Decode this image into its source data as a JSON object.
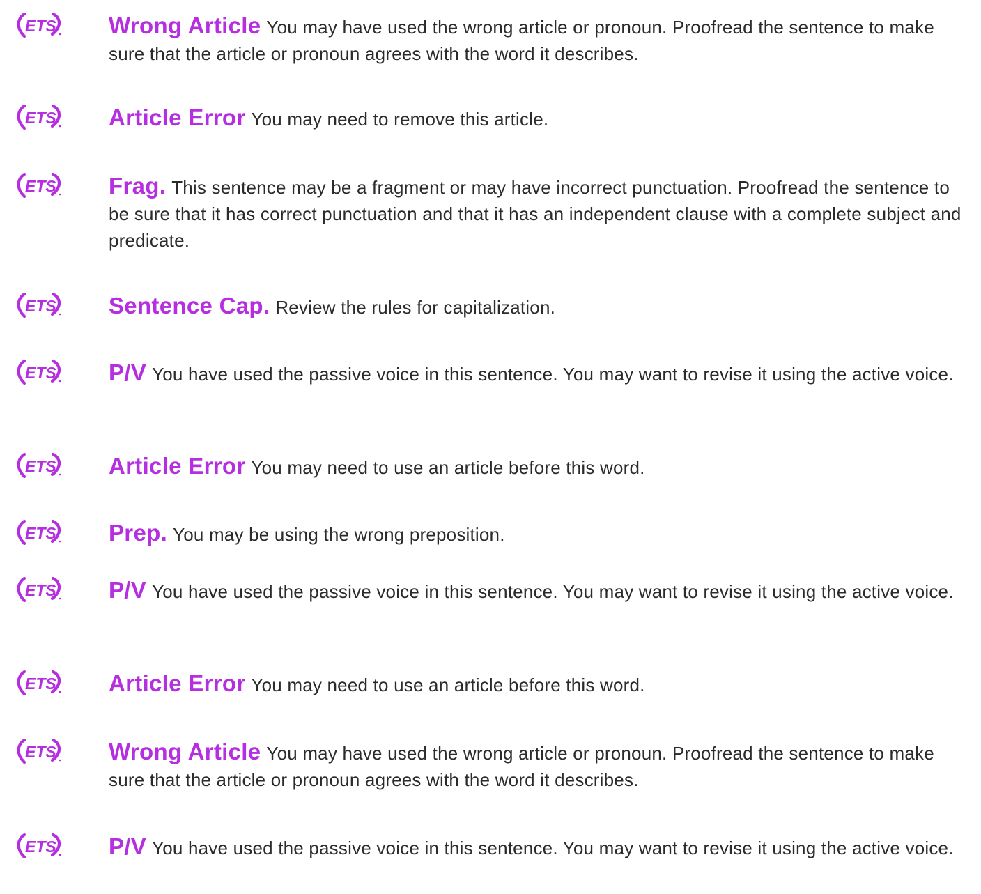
{
  "theme": {
    "accent": "#b52fe0",
    "text": "#2b2b2b",
    "background": "#ffffff"
  },
  "logo": {
    "text": "ETS",
    "icon": "ets-logo-icon"
  },
  "items": [
    {
      "title": "Wrong Article",
      "message": "You may have used the wrong article or pronoun. Proofread the sentence to make sure that the article or pronoun agrees with the word it describes."
    },
    {
      "title": "Article Error",
      "message": "You may need to remove this article."
    },
    {
      "title": "Frag.",
      "message": "This sentence may be a fragment or may have incorrect punctuation. Proofread the sentence to be sure that it has correct punctuation and that it has an independent clause with a complete subject and predicate."
    },
    {
      "title": "Sentence Cap.",
      "message": "Review the rules for capitalization."
    },
    {
      "title": "P/V",
      "message": "You have used the passive voice in this sentence. You may want to revise it using the active voice."
    },
    {
      "title": "Article Error",
      "message": "You may need to use an article before this word."
    },
    {
      "title": "Prep.",
      "message": "You may be using the wrong preposition."
    },
    {
      "title": "P/V",
      "message": "You have used the passive voice in this sentence. You may want to revise it using the active voice."
    },
    {
      "title": "Article Error",
      "message": "You may need to use an article before this word."
    },
    {
      "title": "Wrong Article",
      "message": "You may have used the wrong article or pronoun. Proofread the sentence to make sure that the article or pronoun agrees with the word it describes."
    },
    {
      "title": "P/V",
      "message": "You have used the passive voice in this sentence. You may want to revise it using the active voice."
    }
  ]
}
